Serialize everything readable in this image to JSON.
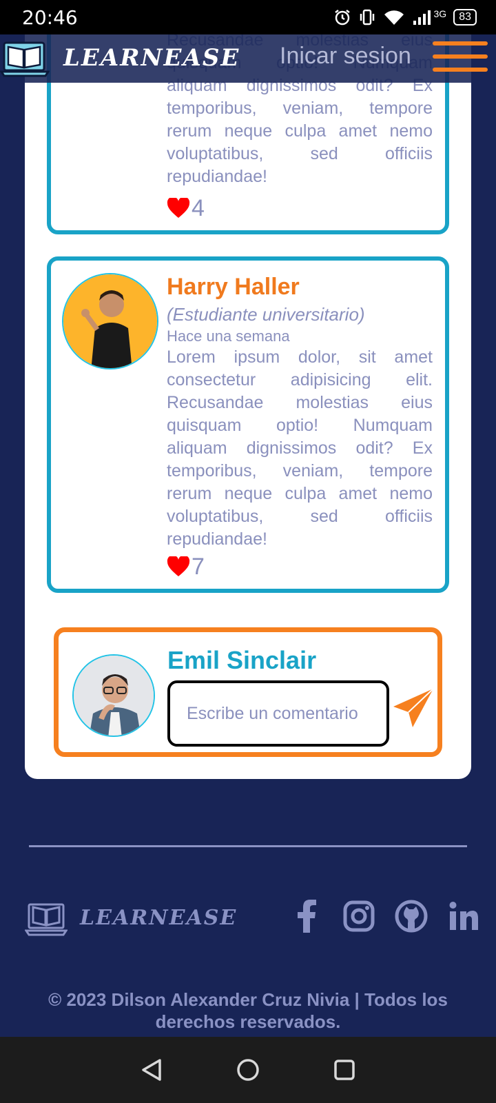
{
  "status": {
    "time": "20:46",
    "network": "3G",
    "battery": "83"
  },
  "header": {
    "brand": "LEARNEASE",
    "login": "Inicar sesion"
  },
  "comments": [
    {
      "text_partial": "Recusandae molestias eius quisquam optio! Numquam aliquam dignissimos odit? Ex temporibus, veniam, tempore rerum neque culpa amet nemo voluptatibus, sed officiis repudiandae!",
      "likes": "4"
    },
    {
      "name": "Harry Haller",
      "role": "(Estudiante universitario)",
      "time": "Hace una semana",
      "text": "Lorem ipsum dolor, sit amet consectetur adipisicing elit. Recusandae molestias eius quisquam optio! Numquam aliquam dignissimos odit? Ex temporibus, veniam, tempore rerum neque culpa amet nemo voluptatibus, sed officiis repudiandae!",
      "likes": "7"
    }
  ],
  "composer": {
    "user_name": "Emil Sinclair",
    "placeholder": "Escribe un comentario"
  },
  "footer": {
    "brand": "LEARNEASE",
    "socials": [
      "facebook-icon",
      "instagram-icon",
      "github-icon",
      "linkedin-icon"
    ],
    "copyright": "© 2023 Dilson Alexander Cruz Nivia | Todos los derechos reservados."
  },
  "colors": {
    "accent": "#f6801f",
    "primary": "#19a3c7",
    "background": "#182456",
    "muted_text": "#8a90bd"
  }
}
